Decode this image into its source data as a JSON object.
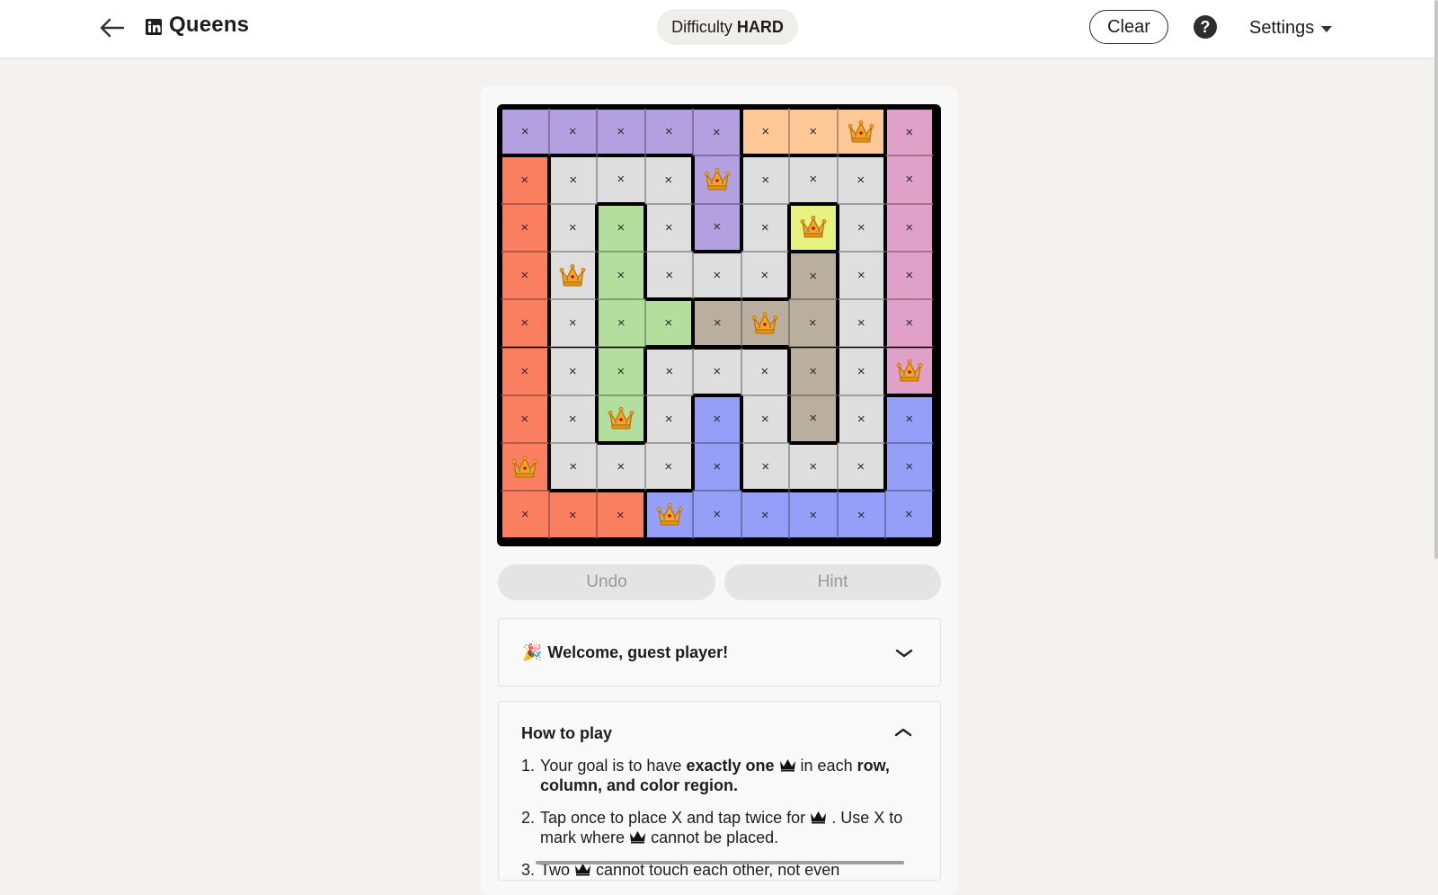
{
  "header": {
    "title": "Queens",
    "difficulty_label": "Difficulty",
    "difficulty_value": "HARD",
    "clear_label": "Clear",
    "help_label": "?",
    "settings_label": "Settings"
  },
  "board": {
    "size": 9,
    "region_colors": {
      "P": "#b3a0e0",
      "O": "#fec896",
      "K": "#e0a1c8",
      "R": "#fa7f61",
      "W": "#dedede",
      "G": "#b3de9e",
      "B": "#969ff8",
      "Y": "#e6f380",
      "T": "#baaf9e"
    },
    "regions": [
      "PPPPPOOOK",
      "RWWWPWWWK",
      "RWGWPWYWK",
      "RWGWWWTWK",
      "RWGGTTTWK",
      "RWGWWWTWK",
      "RWGWBWTWB",
      "RWWWBWWWB",
      "RRRBBBBBB"
    ],
    "cells": [
      "xxxxxxxQx",
      "xxxxQxxxx",
      "xxxxxxQxx",
      "xQxxxxxxx",
      "xxxxxQxxx",
      "xxxxxxxxQ",
      "xxQxxxxxx",
      "Qxxxxxxxx",
      "xxxQxxxxx"
    ],
    "x_mark": "×"
  },
  "actions": {
    "undo_label": "Undo",
    "hint_label": "Hint"
  },
  "welcome": {
    "emoji": "🎉",
    "title": "Welcome, guest player!"
  },
  "how_to_play": {
    "title": "How to play",
    "rule1": {
      "num": "1.",
      "a": "Your goal is to have ",
      "b": "exactly one",
      "c": " in each ",
      "d": "row, column, and color region."
    },
    "rule2": {
      "num": "2.",
      "a": "Tap once to place X and tap twice for",
      "b": ". Use X to mark where",
      "c": "cannot be placed."
    },
    "rule3": {
      "num": "3.",
      "a": "Two",
      "b": "cannot touch each other, not even"
    }
  }
}
